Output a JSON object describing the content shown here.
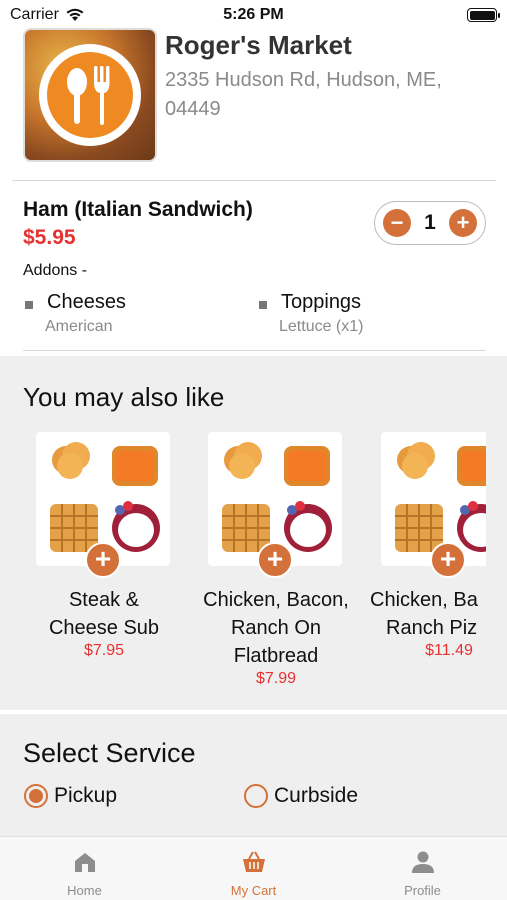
{
  "status_bar": {
    "carrier": "Carrier",
    "time": "5:26 PM"
  },
  "store": {
    "name": "Roger's Market",
    "address": "2335 Hudson Rd, Hudson, ME, 04449",
    "logo_icon": "fork-spoon-icon"
  },
  "item": {
    "title": "Ham (Italian Sandwich)",
    "price": "$5.95",
    "quantity": "1",
    "minus_label": "−",
    "plus_label": "+",
    "addons_label": "Addons -",
    "addons": [
      {
        "name": "Cheeses",
        "detail": "American"
      },
      {
        "name": "Toppings",
        "detail": "Lettuce (x1)"
      }
    ]
  },
  "recommendations": {
    "title": "You may also like",
    "items": [
      {
        "name_lines": [
          "Steak &",
          "Cheese Sub"
        ],
        "price": "$7.95"
      },
      {
        "name_lines": [
          "Chicken, Bacon,",
          "Ranch On",
          "Flatbread"
        ],
        "price": "$7.99"
      },
      {
        "name_lines": [
          "Chicken, Ba",
          "Ranch Piz"
        ],
        "price": "$11.49"
      }
    ],
    "add_label": "+"
  },
  "service": {
    "title": "Select Service",
    "options": [
      {
        "label": "Pickup",
        "selected": true
      },
      {
        "label": "Curbside",
        "selected": false
      }
    ]
  },
  "tabs": [
    {
      "label": "Home",
      "icon": "home-icon",
      "active": false
    },
    {
      "label": "My Cart",
      "icon": "basket-icon",
      "active": true
    },
    {
      "label": "Profile",
      "icon": "person-icon",
      "active": false
    }
  ],
  "colors": {
    "accent": "#d4713a",
    "price": "#e5312f",
    "muted": "#8a8a8a",
    "section_bg": "#efefef"
  }
}
